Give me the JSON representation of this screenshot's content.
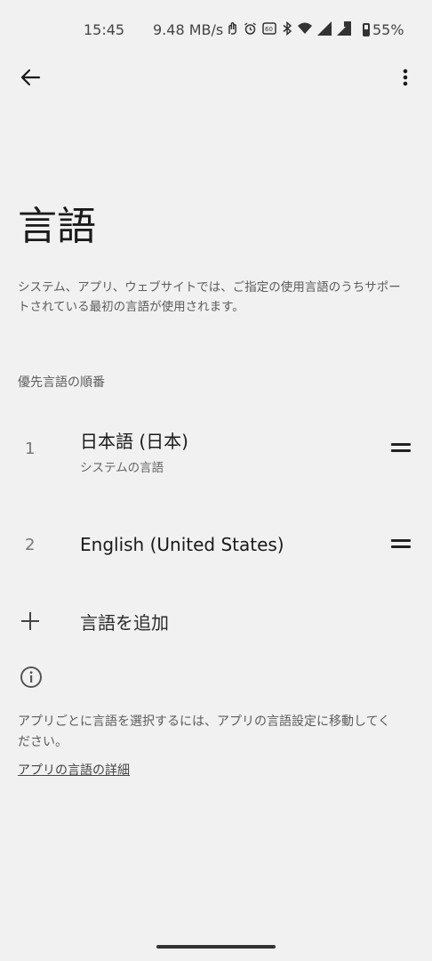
{
  "status_bar": {
    "time": "15:45",
    "speed": "9.48 MB/s",
    "icons": [
      "hand-icon",
      "alarm-icon",
      "hd-icon",
      "bluetooth-icon",
      "wifi-icon",
      "signal-icon",
      "signal-2-icon"
    ],
    "battery": "55%"
  },
  "app_bar": {
    "back_icon": "arrow-left-icon",
    "more_icon": "more-vert-icon"
  },
  "page": {
    "title": "言語",
    "description": "システム、アプリ、ウェブサイトでは、ご指定の使用言語のうちサポートされている最初の言語が使用されます。"
  },
  "preferred": {
    "label": "優先言語の順番",
    "items": [
      {
        "index": "1",
        "name": "日本語 (日本)",
        "subtitle": "システムの言語"
      },
      {
        "index": "2",
        "name": "English (United States)",
        "subtitle": ""
      }
    ]
  },
  "add_language": {
    "label": "言語を追加"
  },
  "app_languages": {
    "info_text": "アプリごとに言語を選択するには、アプリの言語設定に移動してください。",
    "link": "アプリの言語の詳細"
  },
  "colors": {
    "background": "#f1f1f1",
    "text": "#1a1a1a",
    "secondary": "#5c5c5c"
  }
}
